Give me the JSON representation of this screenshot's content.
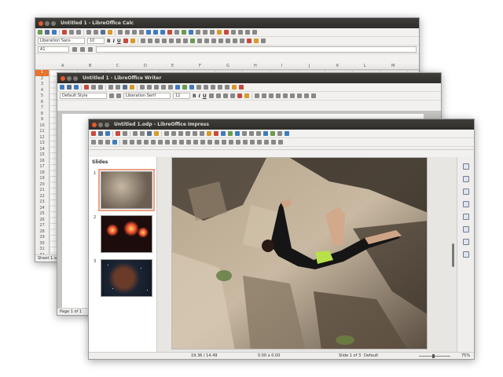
{
  "calc": {
    "title": "Untitled 1 - LibreOffice Calc",
    "font_name": "Liberation Sans",
    "font_size": "10",
    "name_box": "A1",
    "columns": [
      "A",
      "B",
      "C",
      "D",
      "E",
      "F",
      "G",
      "H",
      "I",
      "J",
      "K",
      "L",
      "M"
    ],
    "rows": [
      "1",
      "2",
      "3",
      "4",
      "5",
      "6",
      "7",
      "8",
      "9",
      "10",
      "11",
      "12",
      "13",
      "14",
      "15",
      "16",
      "17",
      "18",
      "19",
      "20",
      "21",
      "22",
      "23",
      "24",
      "25",
      "26",
      "27",
      "28",
      "29",
      "30",
      "31",
      "32"
    ],
    "sheet_status": "Sheet 1 of 1"
  },
  "writer": {
    "title": "Untitled 1 - LibreOffice Writer",
    "paragraph_style": "Default Style",
    "font_name": "Liberation Serif",
    "font_size": "12",
    "page_status": "Page 1 of 1"
  },
  "impress": {
    "title": "Untitled 1.odp - LibreOffice Impress",
    "slides_panel_title": "Slides",
    "slide_numbers": [
      "1",
      "2",
      "3"
    ],
    "status": {
      "position": "19.36 / 14.49",
      "size": "0.00 x 0.00",
      "slide": "Slide 1 of 3",
      "layout": "Default",
      "zoom": "75%"
    },
    "zoom_level": 0.45
  },
  "colors": {
    "titlebar": "#3c3b37",
    "close_button": "#e6592c",
    "selection": "#e8732c"
  }
}
